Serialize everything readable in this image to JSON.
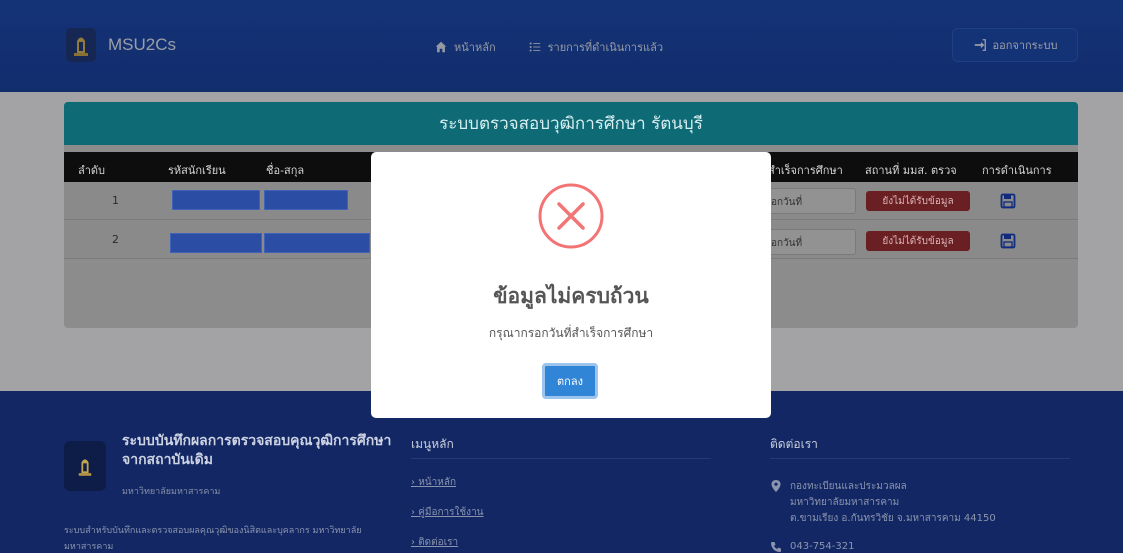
{
  "navbar": {
    "brand_name": "MSU2Cs",
    "home_label": "หน้าหลัก",
    "done_list_label": "รายการที่ดำเนินการแล้ว",
    "logout_label": "ออกจากระบบ"
  },
  "card": {
    "title": "ระบบตรวจสอบวุฒิการศึกษา รัตนบุรี",
    "columns": {
      "order": "ลำดับ",
      "student_id": "รหัสนักเรียน",
      "name": "ชื่อ-สกุล",
      "graduation": "สำเร็จการศึกษา",
      "msu_check_place": "สถานที่ มมส. ตรวจ",
      "action": "การดำเนินการ"
    },
    "rows": [
      {
        "order": "1",
        "date_placeholder": "อกวันที่",
        "status": "ยังไม่ได้รับข้อมูล"
      },
      {
        "order": "2",
        "date_placeholder": "อกวันที่",
        "status": "ยังไม่ได้รับข้อมูล"
      }
    ]
  },
  "modal": {
    "title": "ข้อมูลไม่ครบถ้วน",
    "message": "กรุณากรอกวันที่สำเร็จการศึกษา",
    "ok_label": "ตกลง"
  },
  "footer": {
    "title": "ระบบบันทึกผลการตรวจสอบคุณวุฒิการศึกษาจากสถาบันเดิม",
    "subtitle": "มหาวิทยาลัยมหาสารคาม",
    "description": "ระบบสำหรับบันทึกและตรวจสอบผลคุณวุฒิของนิสิตและบุคลากร มหาวิทยาลัยมหาสารคาม",
    "menu_title": "เมนูหลัก",
    "menu_links": [
      "หน้าหลัก",
      "คู่มือการใช้งาน",
      "ติดต่อเรา"
    ],
    "contact_title": "ติดต่อเรา",
    "address_line1": "กองทะเบียนและประมวลผล",
    "address_line2": "มหาวิทยาลัยมหาสารคาม",
    "address_line3": "ต.ขามเรียง อ.กันทรวิชัย จ.มหาสารคาม 44150",
    "phone": "043-754-321"
  },
  "colors": {
    "navbar": "#1e4bb0",
    "card_header": "#17a2b8",
    "status_badge": "#dc3545",
    "ok_button": "#3085d6",
    "error_icon": "#f27474",
    "footer": "#1a3a9c"
  }
}
